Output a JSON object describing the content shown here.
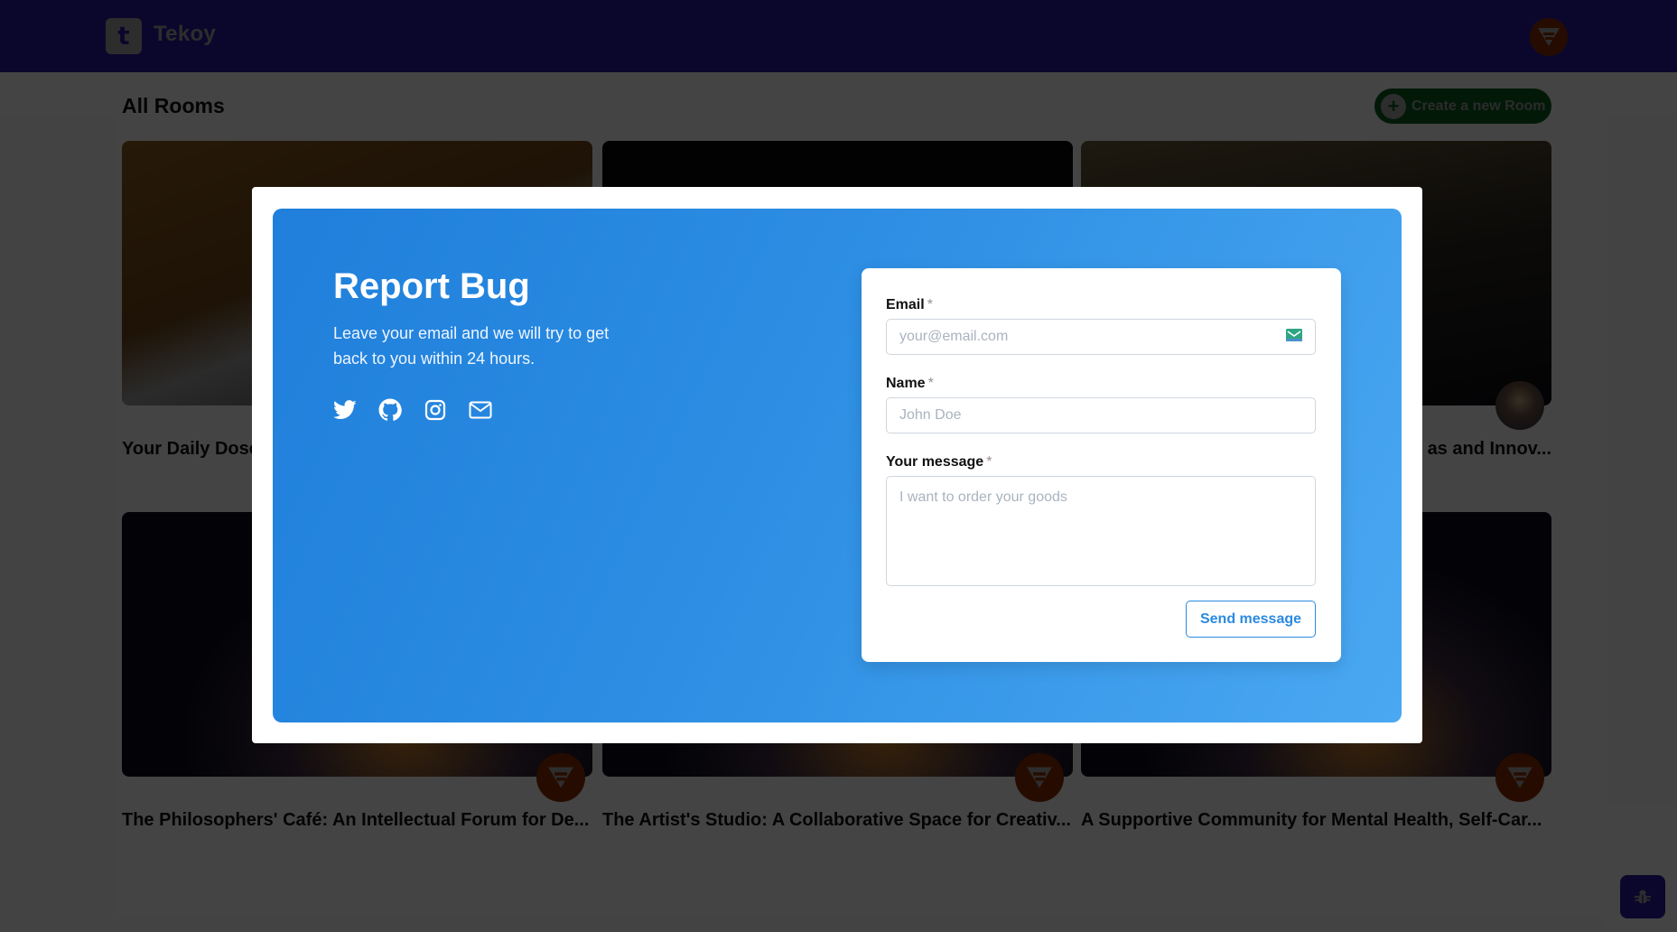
{
  "app": {
    "brand": "Tekoy",
    "logo_letter": "t"
  },
  "page": {
    "title": "All Rooms",
    "create_button_label": "Create a new Room"
  },
  "rooms": [
    {
      "title": "Your Daily Dose of Inspiration",
      "visible_title": "Your Daily Dose"
    },
    {
      "title": ""
    },
    {
      "title": "as and Innov..."
    },
    {
      "title": "The Philosophers' Café: An Intellectual Forum for De..."
    },
    {
      "title": "The Artist's Studio: A Collaborative Space for Creativ..."
    },
    {
      "title": "A Supportive Community for Mental Health, Self-Car..."
    }
  ],
  "modal": {
    "title": "Report Bug",
    "description": "Leave your email and we will try to get back to you within 24 hours.",
    "socials": [
      "twitter-icon",
      "github-icon",
      "instagram-icon",
      "mail-icon"
    ],
    "form": {
      "email": {
        "label": "Email",
        "required_mark": "*",
        "placeholder": "your@email.com",
        "value": ""
      },
      "name": {
        "label": "Name",
        "required_mark": "*",
        "placeholder": "John Doe",
        "value": ""
      },
      "message": {
        "label": "Your message",
        "required_mark": "*",
        "placeholder": "I want to order your goods",
        "value": ""
      },
      "submit_label": "Send message"
    }
  },
  "colors": {
    "header": "#2a1a9e",
    "accent_blue": "#2a8ae0",
    "create_green": "#0d5b1f",
    "avatar_orange": "#8a2e00"
  }
}
